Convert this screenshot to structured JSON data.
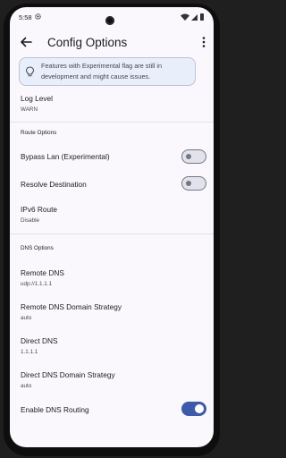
{
  "status_bar": {
    "time": "5:58"
  },
  "toolbar": {
    "title": "Config Options"
  },
  "notice": {
    "text": "Features with Experimental flag are still in development and might cause issues."
  },
  "settings": {
    "log_level": {
      "title": "Log Level",
      "value": "WARN"
    },
    "route_section": "Route Options",
    "bypass_lan": {
      "title": "Bypass Lan (Experimental)",
      "enabled": false
    },
    "resolve_destination": {
      "title": "Resolve Destination",
      "enabled": false
    },
    "ipv6_route": {
      "title": "IPv6 Route",
      "value": "Disable"
    },
    "dns_section": "DNS Options",
    "remote_dns": {
      "title": "Remote DNS",
      "value": "udp://1.1.1.1"
    },
    "remote_dns_strategy": {
      "title": "Remote DNS Domain Strategy",
      "value": "auto"
    },
    "direct_dns": {
      "title": "Direct DNS",
      "value": "1.1.1.1"
    },
    "direct_dns_strategy": {
      "title": "Direct DNS Domain Strategy",
      "value": "auto"
    },
    "enable_dns_routing": {
      "title": "Enable DNS Routing",
      "enabled": true
    }
  },
  "colors": {
    "accent": "#3d5ba9",
    "notice_bg": "#e9eefb",
    "screen_bg": "#fbf8fd"
  }
}
